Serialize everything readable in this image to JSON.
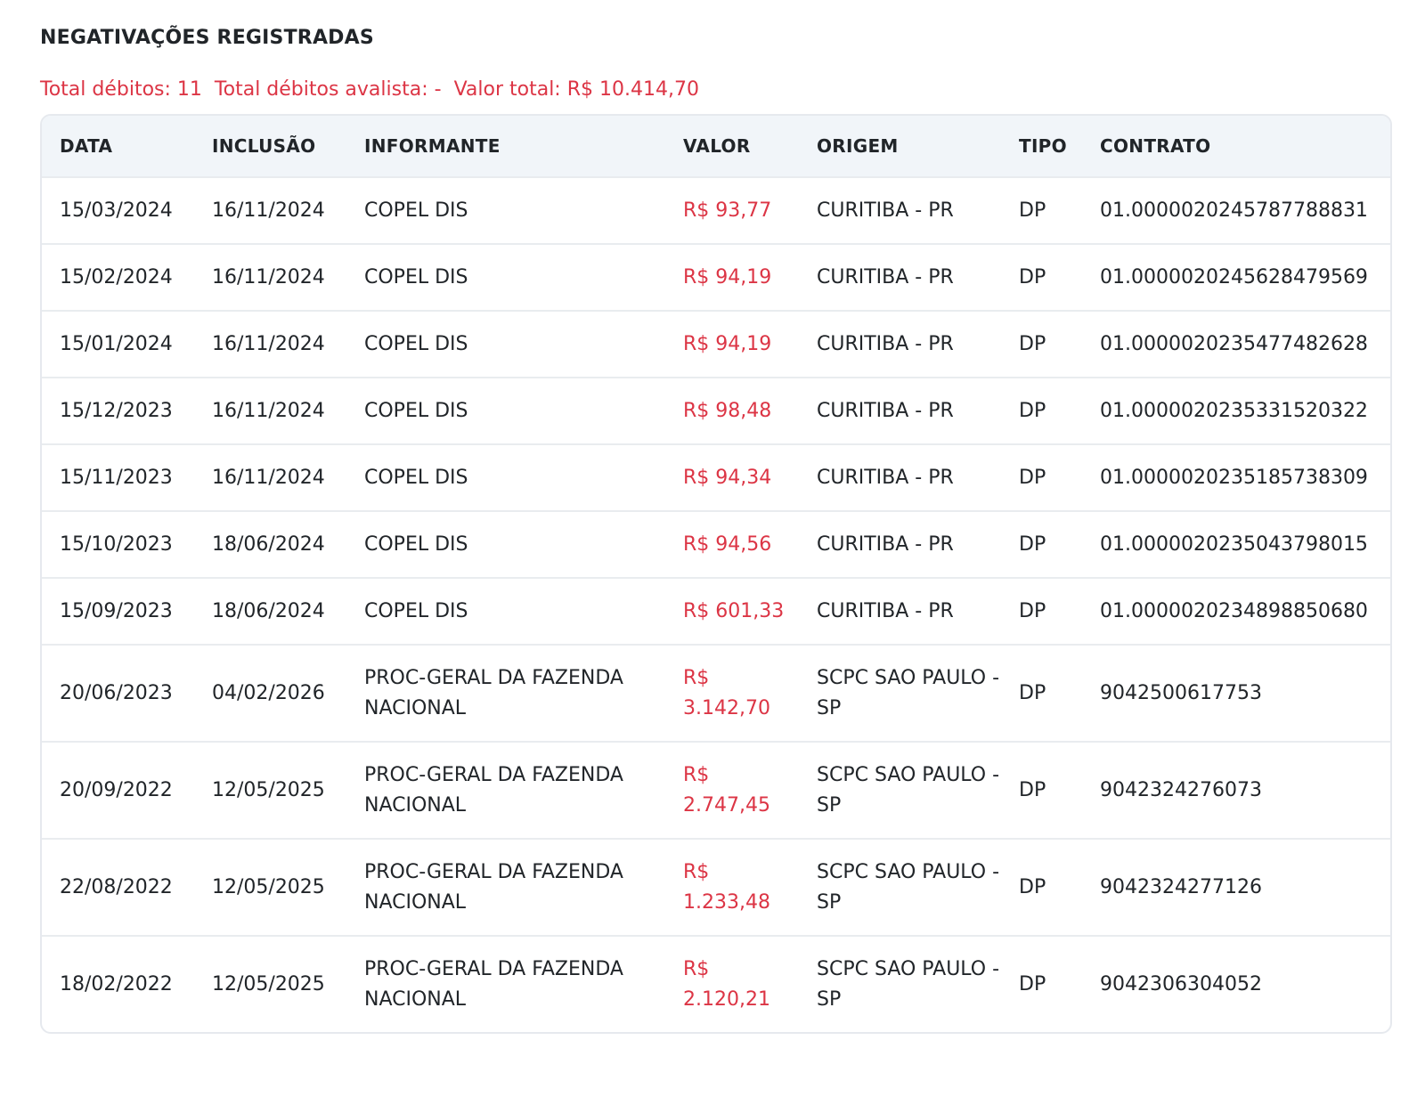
{
  "section": {
    "title": "NEGATIVAÇÕES REGISTRADAS"
  },
  "summary": {
    "total_debitos_label": "Total débitos:",
    "total_debitos_value": "11",
    "total_avalista_label": "Total débitos avalista:",
    "total_avalista_value": "-",
    "valor_total_label": "Valor total:",
    "valor_total_value": "R$ 10.414,70"
  },
  "table": {
    "headers": [
      "DATA",
      "INCLUSÃO",
      "INFORMANTE",
      "VALOR",
      "ORIGEM",
      "TIPO",
      "CONTRATO"
    ],
    "rows": [
      {
        "data": "15/03/2024",
        "inclusao": "16/11/2024",
        "informante": "COPEL DIS",
        "valor": "R$ 93,77",
        "origem": "CURITIBA - PR",
        "tipo": "DP",
        "contrato": "01.0000020245787788831"
      },
      {
        "data": "15/02/2024",
        "inclusao": "16/11/2024",
        "informante": "COPEL DIS",
        "valor": "R$ 94,19",
        "origem": "CURITIBA - PR",
        "tipo": "DP",
        "contrato": "01.0000020245628479569"
      },
      {
        "data": "15/01/2024",
        "inclusao": "16/11/2024",
        "informante": "COPEL DIS",
        "valor": "R$ 94,19",
        "origem": "CURITIBA - PR",
        "tipo": "DP",
        "contrato": "01.0000020235477482628"
      },
      {
        "data": "15/12/2023",
        "inclusao": "16/11/2024",
        "informante": "COPEL DIS",
        "valor": "R$ 98,48",
        "origem": "CURITIBA - PR",
        "tipo": "DP",
        "contrato": "01.0000020235331520322"
      },
      {
        "data": "15/11/2023",
        "inclusao": "16/11/2024",
        "informante": "COPEL DIS",
        "valor": "R$ 94,34",
        "origem": "CURITIBA - PR",
        "tipo": "DP",
        "contrato": "01.0000020235185738309"
      },
      {
        "data": "15/10/2023",
        "inclusao": "18/06/2024",
        "informante": "COPEL DIS",
        "valor": "R$ 94,56",
        "origem": "CURITIBA - PR",
        "tipo": "DP",
        "contrato": "01.0000020235043798015"
      },
      {
        "data": "15/09/2023",
        "inclusao": "18/06/2024",
        "informante": "COPEL DIS",
        "valor": "R$ 601,33",
        "origem": "CURITIBA - PR",
        "tipo": "DP",
        "contrato": "01.0000020234898850680"
      },
      {
        "data": "20/06/2023",
        "inclusao": "04/02/2026",
        "informante": "PROC-GERAL DA FAZENDA NACIONAL",
        "valor": "R$ 3.142,70",
        "origem": "SCPC SAO PAULO - SP",
        "tipo": "DP",
        "contrato": "9042500617753"
      },
      {
        "data": "20/09/2022",
        "inclusao": "12/05/2025",
        "informante": "PROC-GERAL DA FAZENDA NACIONAL",
        "valor": "R$ 2.747,45",
        "origem": "SCPC SAO PAULO - SP",
        "tipo": "DP",
        "contrato": "9042324276073"
      },
      {
        "data": "22/08/2022",
        "inclusao": "12/05/2025",
        "informante": "PROC-GERAL DA FAZENDA NACIONAL",
        "valor": "R$ 1.233,48",
        "origem": "SCPC SAO PAULO - SP",
        "tipo": "DP",
        "contrato": "9042324277126"
      },
      {
        "data": "18/02/2022",
        "inclusao": "12/05/2025",
        "informante": "PROC-GERAL DA FAZENDA NACIONAL",
        "valor": "R$ 2.120,21",
        "origem": "SCPC SAO PAULO - SP",
        "tipo": "DP",
        "contrato": "9042306304052"
      }
    ]
  },
  "colors": {
    "accent_red": "#dc3545",
    "header_bg": "#f1f5f9",
    "text": "#212529"
  }
}
